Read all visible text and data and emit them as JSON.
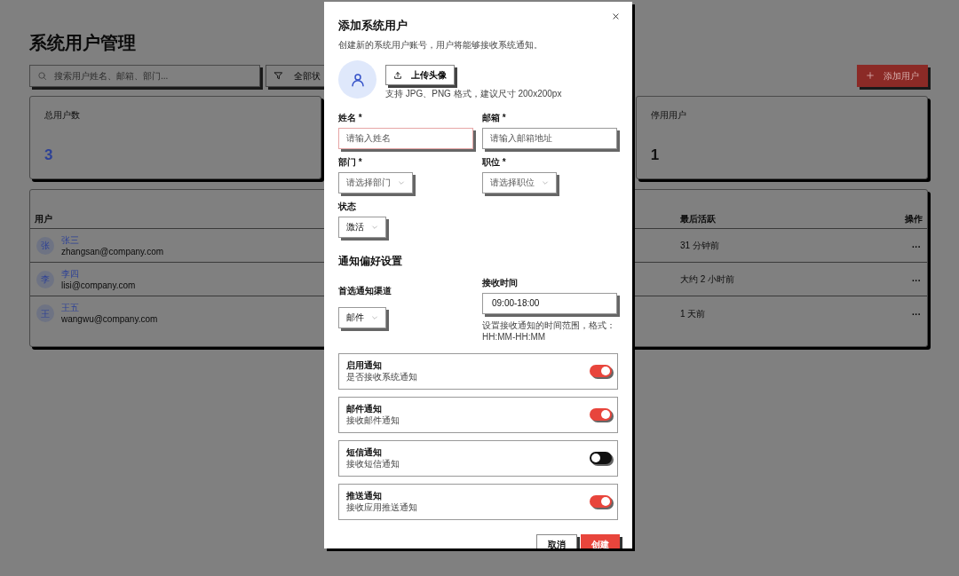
{
  "page": {
    "title": "系统用户管理",
    "search": {
      "placeholder": "搜索用户姓名、邮箱、部门..."
    },
    "filter": {
      "label": "全部状"
    },
    "add_button": {
      "label": "添加用户"
    },
    "stats": [
      {
        "label": "总用户数",
        "value": "3",
        "color": "#2d4196"
      },
      {
        "label": "停用用户",
        "value": "1",
        "color": "#111111"
      }
    ],
    "table": {
      "columns": [
        "用户",
        "最后活跃",
        "操作"
      ],
      "rows": [
        {
          "avatar": "张",
          "name": "张三",
          "email": "zhangsan@company.com",
          "last_active": "31 分钟前",
          "action": "···"
        },
        {
          "avatar": "李",
          "name": "李四",
          "email": "lisi@company.com",
          "last_active": "大约 2 小时前",
          "action": "···"
        },
        {
          "avatar": "王",
          "name": "王五",
          "email": "wangwu@company.com",
          "last_active": "1 天前",
          "action": "···"
        }
      ]
    }
  },
  "dialog": {
    "title": "添加系统用户",
    "subtitle": "创建新的系统用户账号，用户将能够接收系统通知。",
    "upload_button": {
      "label": "上传头像"
    },
    "upload_hint": "支持 JPG、PNG 格式，建议尺寸 200x200px",
    "fields": [
      {
        "kind": "input",
        "label": "姓名 *",
        "placeholder": "请输入姓名",
        "focused": true
      },
      {
        "kind": "input",
        "label": "邮箱 *",
        "placeholder": "请输入邮箱地址",
        "focused": false
      },
      {
        "kind": "select",
        "label": "部门 *",
        "placeholder": "请选择部门"
      },
      {
        "kind": "select",
        "label": "职位 *",
        "placeholder": "请选择职位"
      },
      {
        "kind": "select",
        "label": "状态",
        "value": "激活"
      }
    ],
    "section_title": "通知偏好设置",
    "channel": {
      "label": "首选通知渠道",
      "value": "邮件"
    },
    "time": {
      "label": "接收时间",
      "value": "09:00-18:00",
      "help": "设置接收通知的时间范围，格式：HH:MM-HH:MM"
    },
    "toggles": [
      {
        "title": "启用通知",
        "description": "是否接收系统通知",
        "on": true
      },
      {
        "title": "邮件通知",
        "description": "接收邮件通知",
        "on": true
      },
      {
        "title": "短信通知",
        "description": "接收短信通知",
        "on": false
      },
      {
        "title": "推送通知",
        "description": "接收应用推送通知",
        "on": true
      }
    ],
    "buttons": [
      {
        "kind": "secondary",
        "label": "取消"
      },
      {
        "kind": "primary",
        "label": "创建"
      }
    ]
  }
}
